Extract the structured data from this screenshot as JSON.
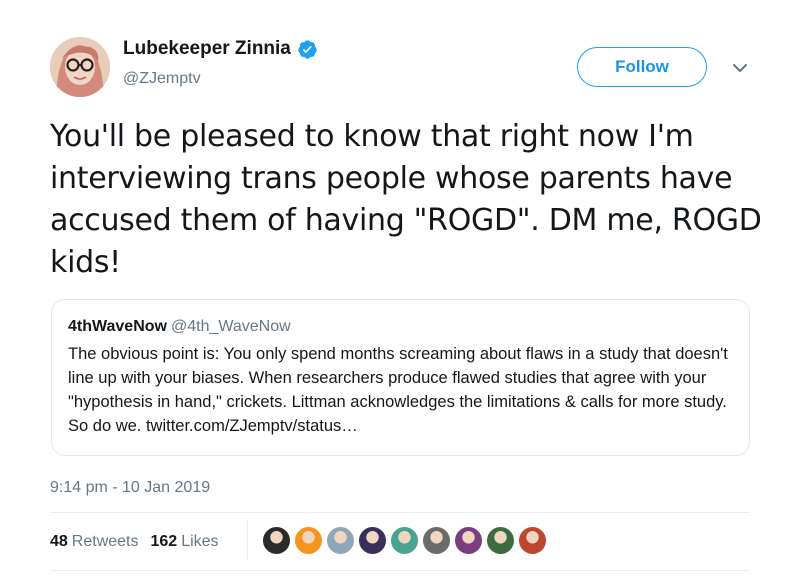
{
  "author": {
    "display_name": "Lubekeeper Zinnia",
    "handle": "@ZJemptv",
    "avatar_icon": "avatar-woman-glasses",
    "verified_icon": "verified-badge-icon"
  },
  "follow_button": {
    "label": "Follow"
  },
  "tweet": {
    "text": "You'll be pleased to know that right now I'm interviewing trans people whose parents have accused them of having \"ROGD\". DM me, ROGD kids!",
    "timestamp": "9:14 pm - 10 Jan 2019"
  },
  "quote": {
    "name": "4thWaveNow",
    "handle": "@4th_WaveNow",
    "text": "The obvious point is: You only spend months screaming about flaws in a study that doesn't line up with your biases. When researchers produce flawed studies that agree with your \"hypothesis in hand,\" crickets. Littman acknowledges the limitations & calls for more study. So do we. twitter.com/ZJemptv/status…"
  },
  "stats": {
    "retweets_count": "48",
    "retweets_label": "Retweets",
    "likes_count": "162",
    "likes_label": "Likes"
  },
  "likers": [
    {
      "name": "liker-avatar-1",
      "color": "#2b2b2b"
    },
    {
      "name": "liker-avatar-2",
      "color": "#f7931e"
    },
    {
      "name": "liker-avatar-3",
      "color": "#8fa7b8"
    },
    {
      "name": "liker-avatar-4",
      "color": "#3a2f5a"
    },
    {
      "name": "liker-avatar-5",
      "color": "#4aa38f"
    },
    {
      "name": "liker-avatar-6",
      "color": "#6b6b6b"
    },
    {
      "name": "liker-avatar-7",
      "color": "#7a3e7e"
    },
    {
      "name": "liker-avatar-8",
      "color": "#3d6b3d"
    },
    {
      "name": "liker-avatar-9",
      "color": "#c0452f"
    }
  ],
  "colors": {
    "accent": "#1da1f2",
    "muted": "#657786",
    "text": "#14171a"
  }
}
